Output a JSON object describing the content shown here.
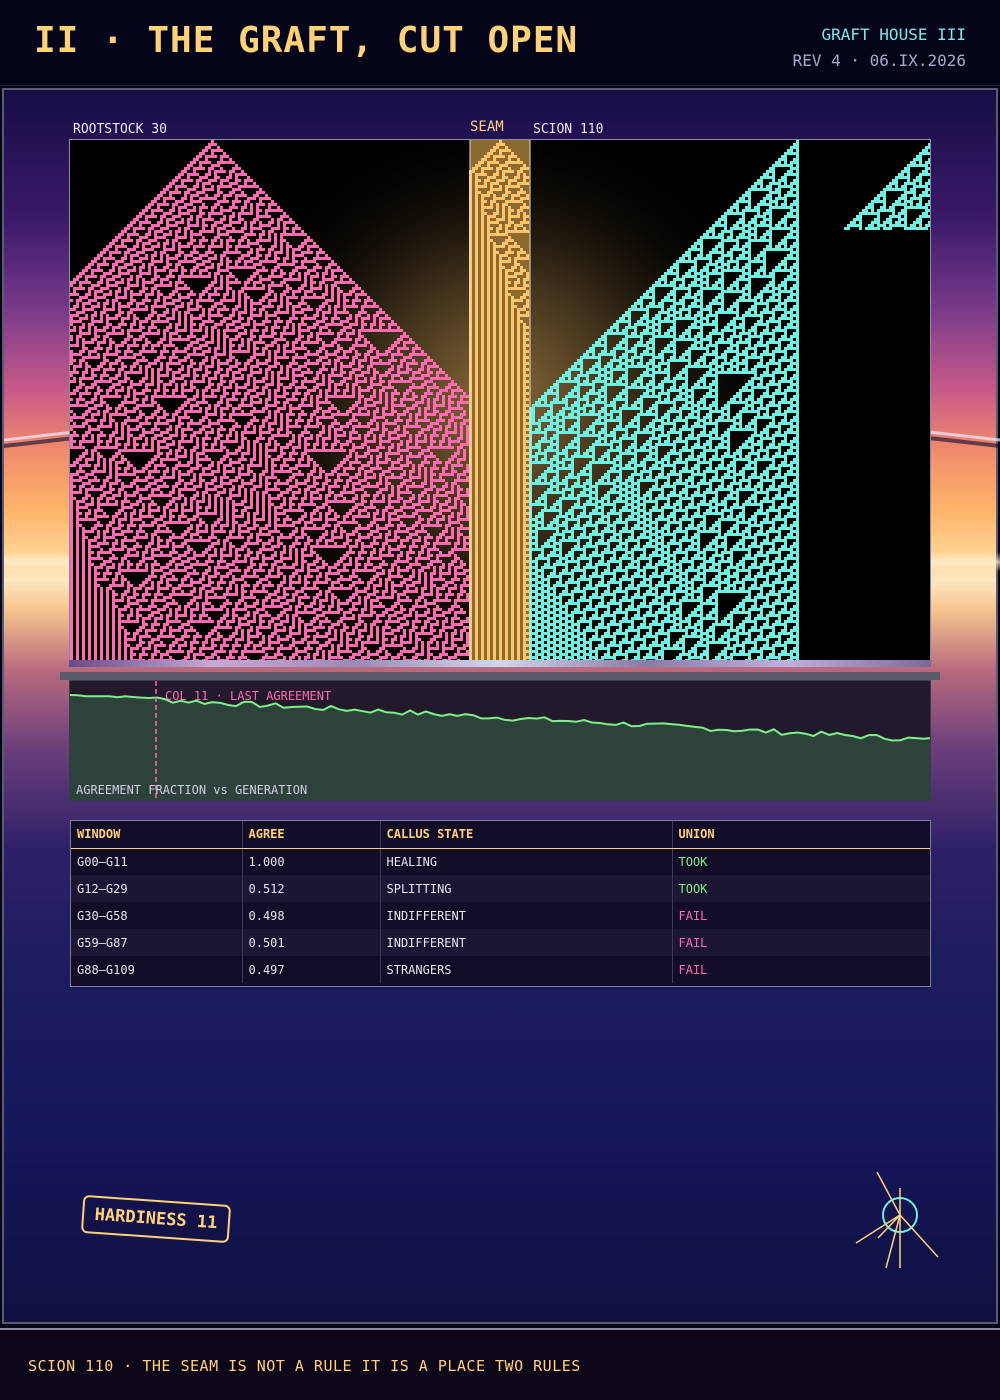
{
  "header": {
    "title": "II · THE GRAFT, CUT OPEN",
    "house": "GRAFT HOUSE III",
    "revision": "REV 4 · 06.IX.2026"
  },
  "labels": {
    "rootstock": "ROOTSTOCK 30",
    "seam": "SEAM",
    "scion": "SCION 110"
  },
  "colors": {
    "rootstock": "#ff6ab0",
    "seam": "#ffc46a",
    "scion": "#6ff0e0",
    "accent": "#ffd27a",
    "took": "#7ef08a",
    "fail": "#ff6ab0"
  },
  "automaton": {
    "rootstock_rule": 30,
    "scion_rule": 110
  },
  "graph": {
    "note": "COL 11 · LAST AGREEMENT",
    "label": "AGREEMENT FRACTION vs GENERATION"
  },
  "table": {
    "headers": [
      "WINDOW",
      "AGREE",
      "CALLUS STATE",
      "UNION"
    ],
    "rows": [
      [
        "G00–G11",
        "1.000",
        "HEALING",
        "TOOK"
      ],
      [
        "G12–G29",
        "0.512",
        "SPLITTING",
        "TOOK"
      ],
      [
        "G30–G58",
        "0.498",
        "INDIFFERENT",
        "FAIL"
      ],
      [
        "G59–G87",
        "0.501",
        "INDIFFERENT",
        "FAIL"
      ],
      [
        "G88–G109",
        "0.497",
        "STRANGERS",
        "FAIL"
      ]
    ]
  },
  "badge": "HARDINESS 11",
  "icons": {
    "compass": "compass-star-icon"
  },
  "footer": "SCION 110 · THE SEAM IS NOT A RULE IT IS A PLACE TWO RULES"
}
